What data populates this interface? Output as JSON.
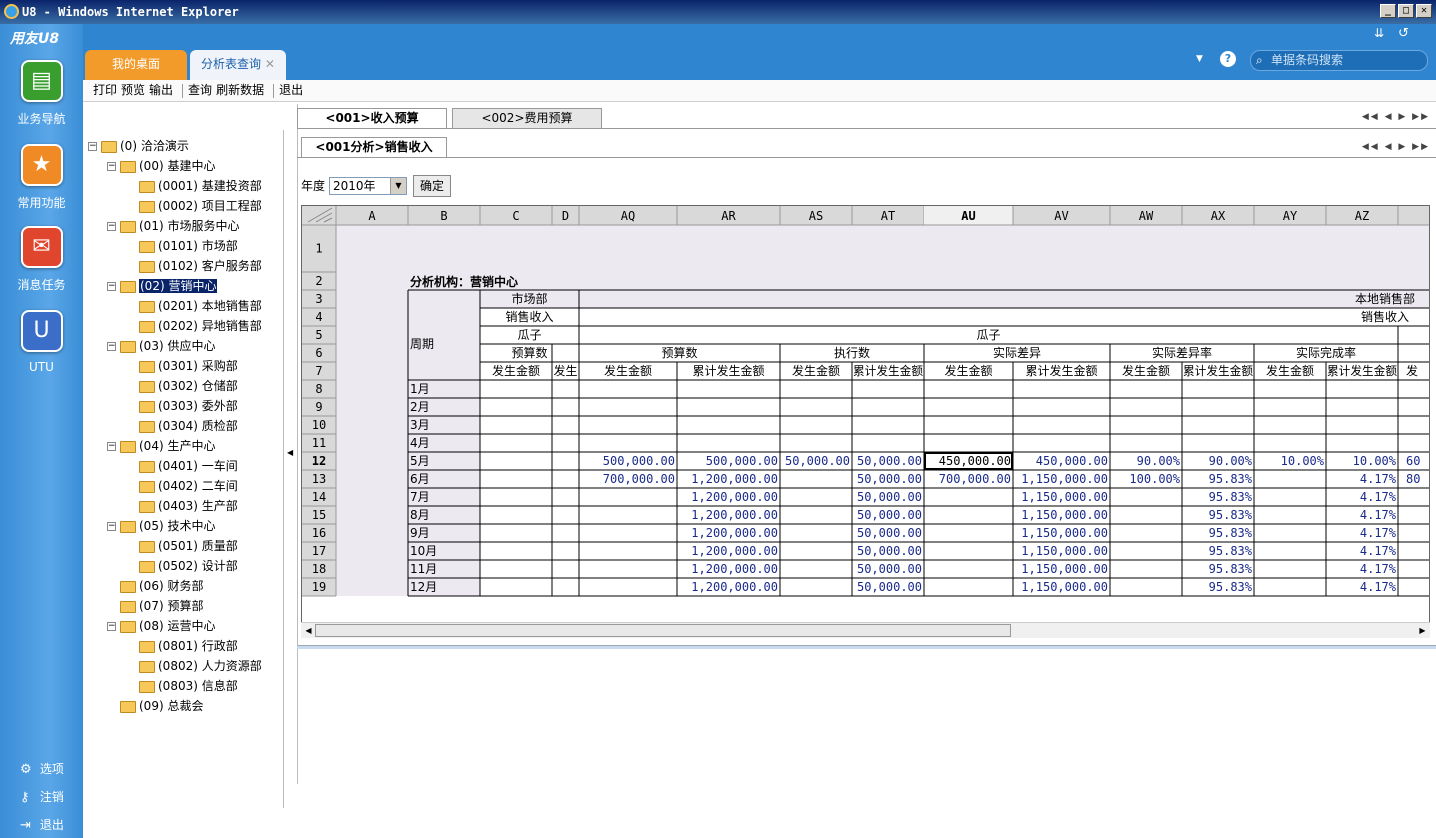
{
  "window": {
    "title": "U8 - Windows Internet Explorer"
  },
  "brand": "用友U8",
  "sidebar": {
    "items": [
      {
        "label": "业务导航",
        "icon": "tree-nav-icon",
        "color": "#3a9e2f"
      },
      {
        "label": "常用功能",
        "icon": "star-icon",
        "color": "#f08a24"
      },
      {
        "label": "消息任务",
        "icon": "message-icon",
        "color": "#e0452e"
      },
      {
        "label": "UTU",
        "icon": "utu-icon",
        "color": "#3a6ec8"
      }
    ],
    "bottom": [
      {
        "label": "选项",
        "icon": "gear-icon"
      },
      {
        "label": "注销",
        "icon": "key-icon"
      },
      {
        "label": "退出",
        "icon": "exit-icon"
      }
    ]
  },
  "tabs": [
    {
      "label": "我的桌面"
    },
    {
      "label": "分析表查询"
    }
  ],
  "search": {
    "placeholder": "单据条码搜索"
  },
  "toolbar": [
    "打印",
    "预览",
    "输出",
    "查询",
    "刷新数据",
    "退出"
  ],
  "tree": [
    {
      "code": "(0) 洽洽演示",
      "level": 0,
      "pm": "-"
    },
    {
      "code": "(00) 基建中心",
      "level": 1,
      "pm": "-"
    },
    {
      "code": "(0001) 基建投资部",
      "level": 2
    },
    {
      "code": "(0002) 项目工程部",
      "level": 2
    },
    {
      "code": "(01) 市场服务中心",
      "level": 1,
      "pm": "-"
    },
    {
      "code": "(0101) 市场部",
      "level": 2
    },
    {
      "code": "(0102) 客户服务部",
      "level": 2
    },
    {
      "code": "(02) 营销中心",
      "level": 1,
      "pm": "-",
      "selected": true
    },
    {
      "code": "(0201) 本地销售部",
      "level": 2
    },
    {
      "code": "(0202) 异地销售部",
      "level": 2
    },
    {
      "code": "(03) 供应中心",
      "level": 1,
      "pm": "-"
    },
    {
      "code": "(0301) 采购部",
      "level": 2
    },
    {
      "code": "(0302) 仓储部",
      "level": 2
    },
    {
      "code": "(0303) 委外部",
      "level": 2
    },
    {
      "code": "(0304) 质检部",
      "level": 2
    },
    {
      "code": "(04) 生产中心",
      "level": 1,
      "pm": "-"
    },
    {
      "code": "(0401) 一车间",
      "level": 2
    },
    {
      "code": "(0402) 二车间",
      "level": 2
    },
    {
      "code": "(0403) 生产部",
      "level": 2
    },
    {
      "code": "(05) 技术中心",
      "level": 1,
      "pm": "-"
    },
    {
      "code": "(0501) 质量部",
      "level": 2
    },
    {
      "code": "(0502) 设计部",
      "level": 2
    },
    {
      "code": "(06) 财务部",
      "level": 1
    },
    {
      "code": "(07) 预算部",
      "level": 1
    },
    {
      "code": "(08) 运营中心",
      "level": 1,
      "pm": "-"
    },
    {
      "code": "(0801) 行政部",
      "level": 2
    },
    {
      "code": "(0802) 人力资源部",
      "level": 2
    },
    {
      "code": "(0803) 信息部",
      "level": 2
    },
    {
      "code": "(09) 总裁会",
      "level": 1
    }
  ],
  "reportTabs": [
    {
      "label": "<001>收入预算"
    },
    {
      "label": "<002>费用预算"
    }
  ],
  "subTab": "<001分析>销售收入",
  "yearLabel": "年度",
  "yearValue": "2010年",
  "okButton": "确定",
  "sheet": {
    "colLetters": [
      "A",
      "B",
      "C",
      "D",
      "AQ",
      "AR",
      "AS",
      "AT",
      "AU",
      "AV",
      "AW",
      "AX",
      "AY",
      "AZ"
    ],
    "rowNumbers": [
      "1",
      "2",
      "3",
      "4",
      "5",
      "6",
      "7",
      "8",
      "9",
      "10",
      "11",
      "12",
      "13",
      "14",
      "15",
      "16",
      "17",
      "18",
      "19"
    ],
    "orgLabel": "分析机构：营销中心",
    "periodLabel": "周期",
    "h3": {
      "c": "市场部",
      "right": "本地销售部"
    },
    "h4": {
      "c": "销售收入",
      "right": "销售收入"
    },
    "h5": {
      "c": "瓜子",
      "center": "瓜子"
    },
    "h6": [
      "预算数",
      "预算数",
      "执行数",
      "实际差异",
      "实际差异率",
      "实际完成率"
    ],
    "h7": [
      "发生金额",
      "发生",
      "发生金额",
      "累计发生金额",
      "发生金额",
      "累计发生金额",
      "发生金额",
      "累计发生金额",
      "发生金额",
      "累计发生金额",
      "发生金额",
      "累计发生金额",
      "发"
    ],
    "months": [
      "1月",
      "2月",
      "3月",
      "4月",
      "5月",
      "6月",
      "7月",
      "8月",
      "9月",
      "10月",
      "11月",
      "12月"
    ],
    "values": [
      [],
      [],
      [],
      [],
      [
        "500,000.00",
        "500,000.00",
        "50,000.00",
        "50,000.00",
        "450,000.00",
        "450,000.00",
        "90.00%",
        "90.00%",
        "10.00%",
        "10.00%",
        "60"
      ],
      [
        "700,000.00",
        "1,200,000.00",
        "",
        "50,000.00",
        "700,000.00",
        "1,150,000.00",
        "100.00%",
        "95.83%",
        "",
        "4.17%",
        "80"
      ],
      [
        "",
        "1,200,000.00",
        "",
        "50,000.00",
        "",
        "1,150,000.00",
        "",
        "95.83%",
        "",
        "4.17%",
        ""
      ],
      [
        "",
        "1,200,000.00",
        "",
        "50,000.00",
        "",
        "1,150,000.00",
        "",
        "95.83%",
        "",
        "4.17%",
        ""
      ],
      [
        "",
        "1,200,000.00",
        "",
        "50,000.00",
        "",
        "1,150,000.00",
        "",
        "95.83%",
        "",
        "4.17%",
        ""
      ],
      [
        "",
        "1,200,000.00",
        "",
        "50,000.00",
        "",
        "1,150,000.00",
        "",
        "95.83%",
        "",
        "4.17%",
        ""
      ],
      [
        "",
        "1,200,000.00",
        "",
        "50,000.00",
        "",
        "1,150,000.00",
        "",
        "95.83%",
        "",
        "4.17%",
        ""
      ],
      [
        "",
        "1,200,000.00",
        "",
        "50,000.00",
        "",
        "1,150,000.00",
        "",
        "95.83%",
        "",
        "4.17%",
        ""
      ]
    ]
  }
}
